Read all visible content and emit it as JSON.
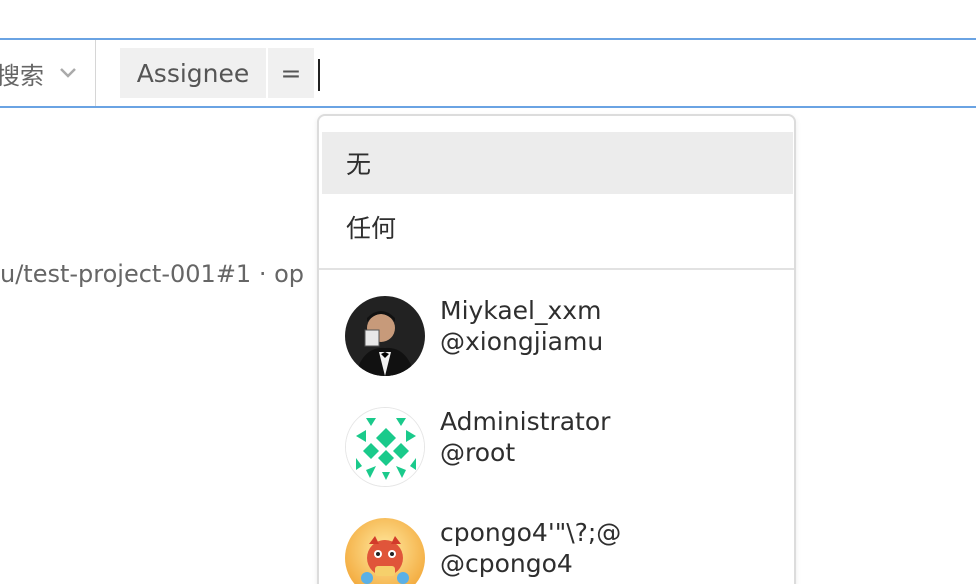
{
  "filter": {
    "scope_label": "搜索",
    "token_key": "Assignee",
    "token_operator": "="
  },
  "background": {
    "issue_ref_text": "u/test-project-001#1 · op"
  },
  "dropdown": {
    "options": [
      {
        "label": "无"
      },
      {
        "label": "任何"
      }
    ],
    "users": [
      {
        "name": "Miykael_xxm",
        "handle": "@xiongjiamu"
      },
      {
        "name": "Administrator",
        "handle": "@root"
      },
      {
        "name": "cpongo4'\"\\?;@",
        "handle": "@cpongo4"
      }
    ]
  },
  "colors": {
    "focus_border": "#6aa3e3",
    "token_bg": "#f0f0f0",
    "highlight_bg": "#ececec",
    "identicon": "#1aca8b"
  }
}
